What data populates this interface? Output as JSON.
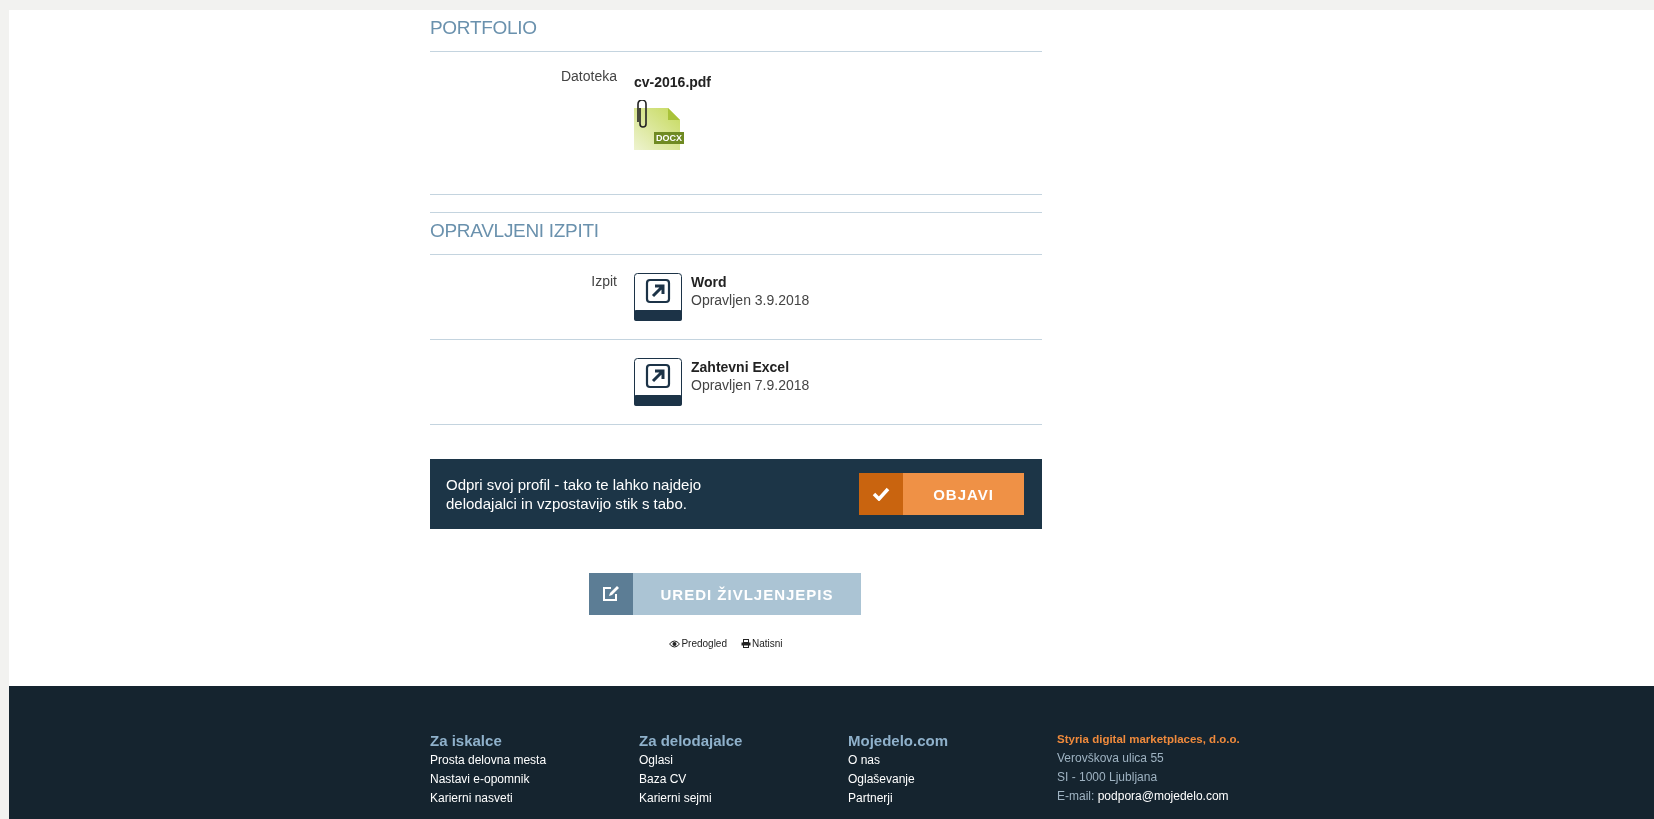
{
  "portfolio": {
    "title": "PORTFOLIO",
    "label": "Datoteka",
    "file_name": "cv-2016.pdf",
    "file_badge": "DOCX"
  },
  "exams": {
    "title": "OPRAVLJENI IZPITI",
    "label": "Izpit",
    "items": [
      {
        "name": "Word",
        "status": "Opravljen 3.9.2018"
      },
      {
        "name": "Zahtevni Excel",
        "status": "Opravljen 7.9.2018"
      }
    ]
  },
  "banner": {
    "text": "Odpri svoj profil - tako te lahko najdejo delodajalci in vzpostavijo stik s tabo.",
    "button": "OBJAVI"
  },
  "edit_button": "UREDI ŽIVLJENJEPIS",
  "links": [
    {
      "kind": "preview",
      "label": "Predogled"
    },
    {
      "kind": "print",
      "label": "Natisni"
    }
  ],
  "footer": {
    "columns": [
      {
        "title": "Za iskalce",
        "items": [
          "Prosta delovna mesta",
          "Nastavi e-opomnik",
          "Karierni nasveti"
        ]
      },
      {
        "title": "Za delodajalce",
        "items": [
          "Oglasi",
          "Baza CV",
          "Karierni sejmi"
        ]
      },
      {
        "title": "Mojedelo.com",
        "items": [
          "O nas",
          "Oglaševanje",
          "Partnerji"
        ]
      }
    ],
    "company": {
      "name": "Styria digital marketplaces, d.o.o.",
      "lines": [
        "Verovškova ulica 55",
        "SI - 1000 Ljubljana"
      ],
      "email_label": "E-mail:",
      "email": "podpora@mojedelo.com"
    }
  }
}
